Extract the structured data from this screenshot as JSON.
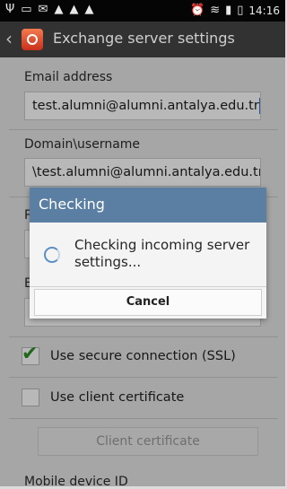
{
  "status_bar": {
    "icons_left": [
      "usb-icon",
      "image-icon",
      "sms-icon",
      "warning-icon",
      "warning-icon",
      "warning-icon"
    ],
    "icons_right": [
      "alarm-icon",
      "wifi-icon",
      "signal-icon",
      "battery-icon"
    ],
    "time": "14:16"
  },
  "action_bar": {
    "title": "Exchange server settings"
  },
  "form": {
    "email_label": "Email address",
    "email_value": "test.alumni@alumni.antalya.edu.tr",
    "domain_label": "Domain\\username",
    "domain_value": "\\test.alumni@alumni.antalya.edu.tr",
    "password_label_partial": "P",
    "exchange_label_partial": "E",
    "ssl_label": "Use secure connection (SSL)",
    "ssl_checked": true,
    "client_cert_label": "Use client certificate",
    "client_cert_checked": false,
    "client_cert_button": "Client certificate",
    "mobile_device_label": "Mobile device ID"
  },
  "dialog": {
    "title": "Checking",
    "message": "Checking incoming server settings...",
    "cancel": "Cancel"
  },
  "colors": {
    "dialog_title_bg": "#5a7fa3",
    "checkmark": "#2f8f26"
  }
}
